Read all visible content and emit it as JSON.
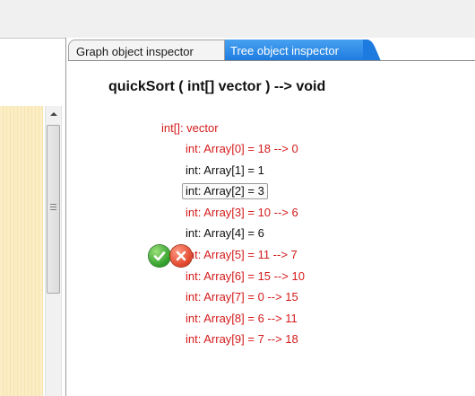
{
  "tabs": [
    {
      "label": "Graph object inspector",
      "active": false
    },
    {
      "label": "Tree object inspector",
      "active": true
    }
  ],
  "method_signature": "quickSort ( int[] vector ) --> void",
  "tree": {
    "root": {
      "label": "int[]: vector",
      "changed": true
    },
    "items": [
      {
        "label": "int: Array[0] = 18 --> 0",
        "changed": true,
        "selected": false
      },
      {
        "label": "int: Array[1] = 1",
        "changed": false,
        "selected": false
      },
      {
        "label": "int: Array[2] = 3",
        "changed": false,
        "selected": true
      },
      {
        "label": "int: Array[3] = 10 --> 6",
        "changed": true,
        "selected": false
      },
      {
        "label": "int: Array[4] = 6",
        "changed": false,
        "selected": false
      },
      {
        "label": "int: Array[5] = 11 --> 7",
        "changed": true,
        "selected": false
      },
      {
        "label": "int: Array[6] = 15 --> 10",
        "changed": true,
        "selected": false
      },
      {
        "label": "int: Array[7] = 0 --> 15",
        "changed": true,
        "selected": false
      },
      {
        "label": "int: Array[8] = 6 --> 11",
        "changed": true,
        "selected": false
      },
      {
        "label": "int: Array[9] = 7 --> 18",
        "changed": true,
        "selected": false
      }
    ]
  },
  "actions": {
    "accept_icon": "check-circle-icon",
    "reject_icon": "x-circle-icon"
  },
  "colors": {
    "changed": "#d41b1b",
    "unchanged": "#111111",
    "active_tab": "#1d7be0",
    "yellow_band": "#fbeec6"
  }
}
